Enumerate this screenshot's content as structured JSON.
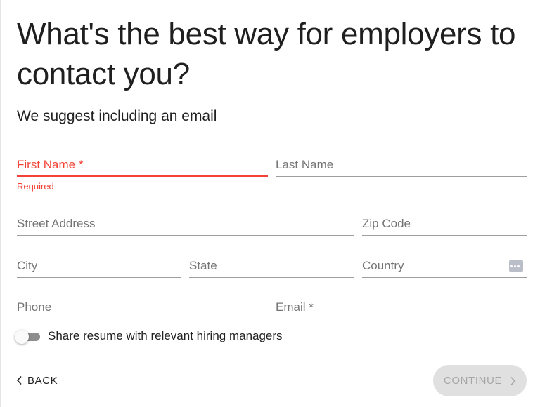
{
  "header": {
    "title": "What's the best way for employers to contact you?",
    "subtitle": "We suggest including an email"
  },
  "fields": {
    "first_name": {
      "label": "First Name *",
      "value": "",
      "error": "Required",
      "state": "error"
    },
    "last_name": {
      "label": "Last Name",
      "value": ""
    },
    "street_address": {
      "label": "Street Address",
      "value": ""
    },
    "zip_code": {
      "label": "Zip Code",
      "value": ""
    },
    "city": {
      "label": "City",
      "value": ""
    },
    "state": {
      "label": "State",
      "value": ""
    },
    "country": {
      "label": "Country",
      "value": "",
      "icon": "picker-icon"
    },
    "phone": {
      "label": "Phone",
      "value": ""
    },
    "email": {
      "label": "Email *",
      "value": ""
    }
  },
  "share_toggle": {
    "label": "Share resume with relevant hiring managers",
    "checked": false
  },
  "actions": {
    "back_label": "BACK",
    "continue_label": "CONTINUE",
    "continue_disabled": true
  },
  "colors": {
    "error": "#f44336",
    "underline": "#9e9e9e",
    "label": "#757575",
    "disabled_button_bg": "#e0e0e0",
    "disabled_button_text": "#a6a6a6"
  }
}
